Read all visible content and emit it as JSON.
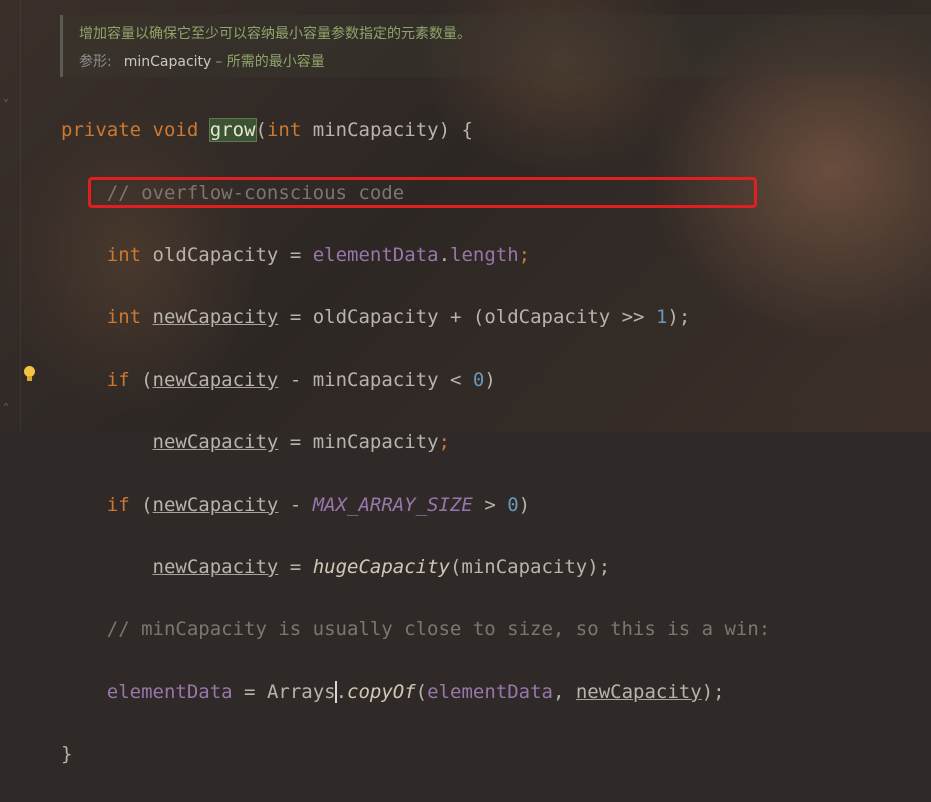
{
  "doc": {
    "summary": "增加容量以确保它至少可以容纳最小容量参数指定的元素数量。",
    "param_tag": "参形:",
    "param_name": "minCapacity",
    "param_desc": "– 所需的最小容量"
  },
  "code": {
    "l1": {
      "kw_private": "private",
      "kw_void": "void",
      "method": "grow",
      "open": "(",
      "kw_int": "int",
      "param": "minCapacity",
      "close": ") {"
    },
    "l2": {
      "comment": "// overflow-conscious code"
    },
    "l3": {
      "kw_int": "int",
      "var": "oldCapacity",
      "eq": " = ",
      "field": "elementData",
      "dot": ".",
      "prop": "length",
      "semi": ";"
    },
    "l4": {
      "kw_int": "int",
      "var": "newCapacity",
      "eq": " = ",
      "a": "oldCapacity",
      "op": " + (",
      "b": "oldCapacity",
      "shift": " >> ",
      "num": "1",
      "end": ");"
    },
    "l5": {
      "kw_if": "if",
      "open": " (",
      "a": "newCapacity",
      "op": " - ",
      "b": "minCapacity",
      "lt": " < ",
      "num": "0",
      "close": ")"
    },
    "l6": {
      "a": "newCapacity",
      "eq": " = ",
      "b": "minCapacity",
      "semi": ";"
    },
    "l7": {
      "kw_if": "if",
      "open": " (",
      "a": "newCapacity",
      "op": " - ",
      "const": "MAX_ARRAY_SIZE",
      "gt": " > ",
      "num": "0",
      "close": ")"
    },
    "l8": {
      "a": "newCapacity",
      "eq": " = ",
      "call": "hugeCapacity",
      "open": "(",
      "arg": "minCapacity",
      "close": ");"
    },
    "l9": {
      "comment": "// minCapacity is usually close to size, so this is a win:"
    },
    "l10": {
      "field": "elementData",
      "eq": " = ",
      "cls": "Arrays",
      "dot": ".",
      "call": "copyOf",
      "open": "(",
      "arg1": "elementData",
      "comma": ", ",
      "arg2": "newCapacity",
      "close": ");"
    },
    "l11": {
      "brace": "}"
    }
  },
  "colors": {
    "keyword": "#cc7832",
    "comment": "#7a7670",
    "field": "#9876aa",
    "number": "#6897bb",
    "doc_text": "#8fa56a",
    "highlight_box": "#e02020"
  },
  "icons": {
    "gutter": "lightbulb-icon",
    "fold": "fold-marker-icon"
  }
}
